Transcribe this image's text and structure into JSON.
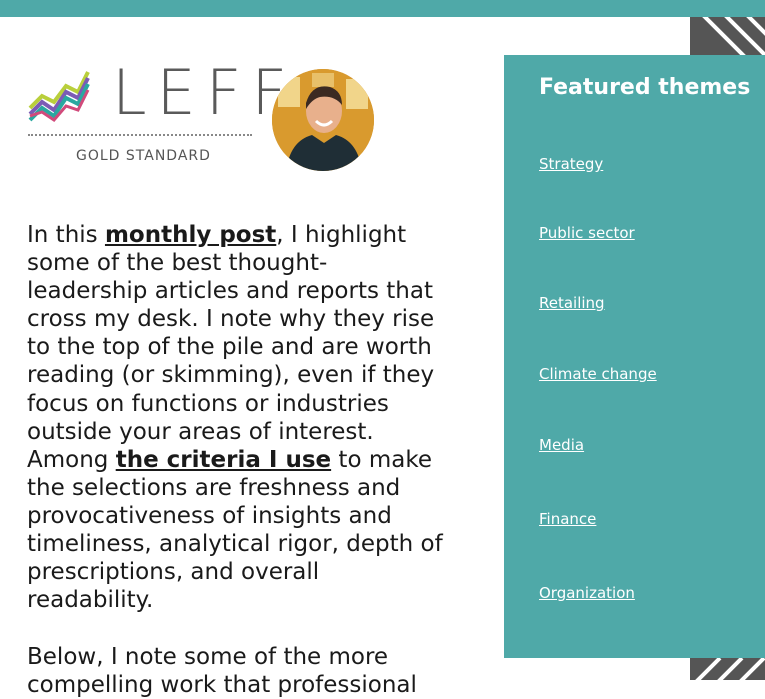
{
  "logo": {
    "word": "LEFF",
    "tagline": "GOLD STANDARD",
    "bar_colors": [
      "#2aa8a0",
      "#7c5bb5",
      "#b9cf3b",
      "#d14a7b"
    ]
  },
  "avatar": {
    "icon": "person-photo"
  },
  "intro": {
    "part1": "In this ",
    "link1": "monthly post",
    "part2": ", I highlight some of the best thought-leadership articles and reports that cross my desk. I note why they rise to the top of the pile and are worth reading (or skimming), even if they focus on functions or industries outside your areas of interest. Among ",
    "link2": "the criteria I use",
    "part3": " to make the selections are freshness and provocativeness of insights and timeliness, analytical rigor, depth of prescriptions, and overall readability.",
    "next": "Below, I note some of the more compelling work that professional"
  },
  "sidebar": {
    "title": "Featured themes",
    "items": [
      {
        "label": "Strategy"
      },
      {
        "label": "Public sector"
      },
      {
        "label": "Retailing"
      },
      {
        "label": "Climate change"
      },
      {
        "label": "Media"
      },
      {
        "label": "Finance"
      },
      {
        "label": "Organization"
      }
    ]
  },
  "colors": {
    "accent": "#4fa9a8",
    "text": "#1a1a1a",
    "stripe": "#555555"
  }
}
